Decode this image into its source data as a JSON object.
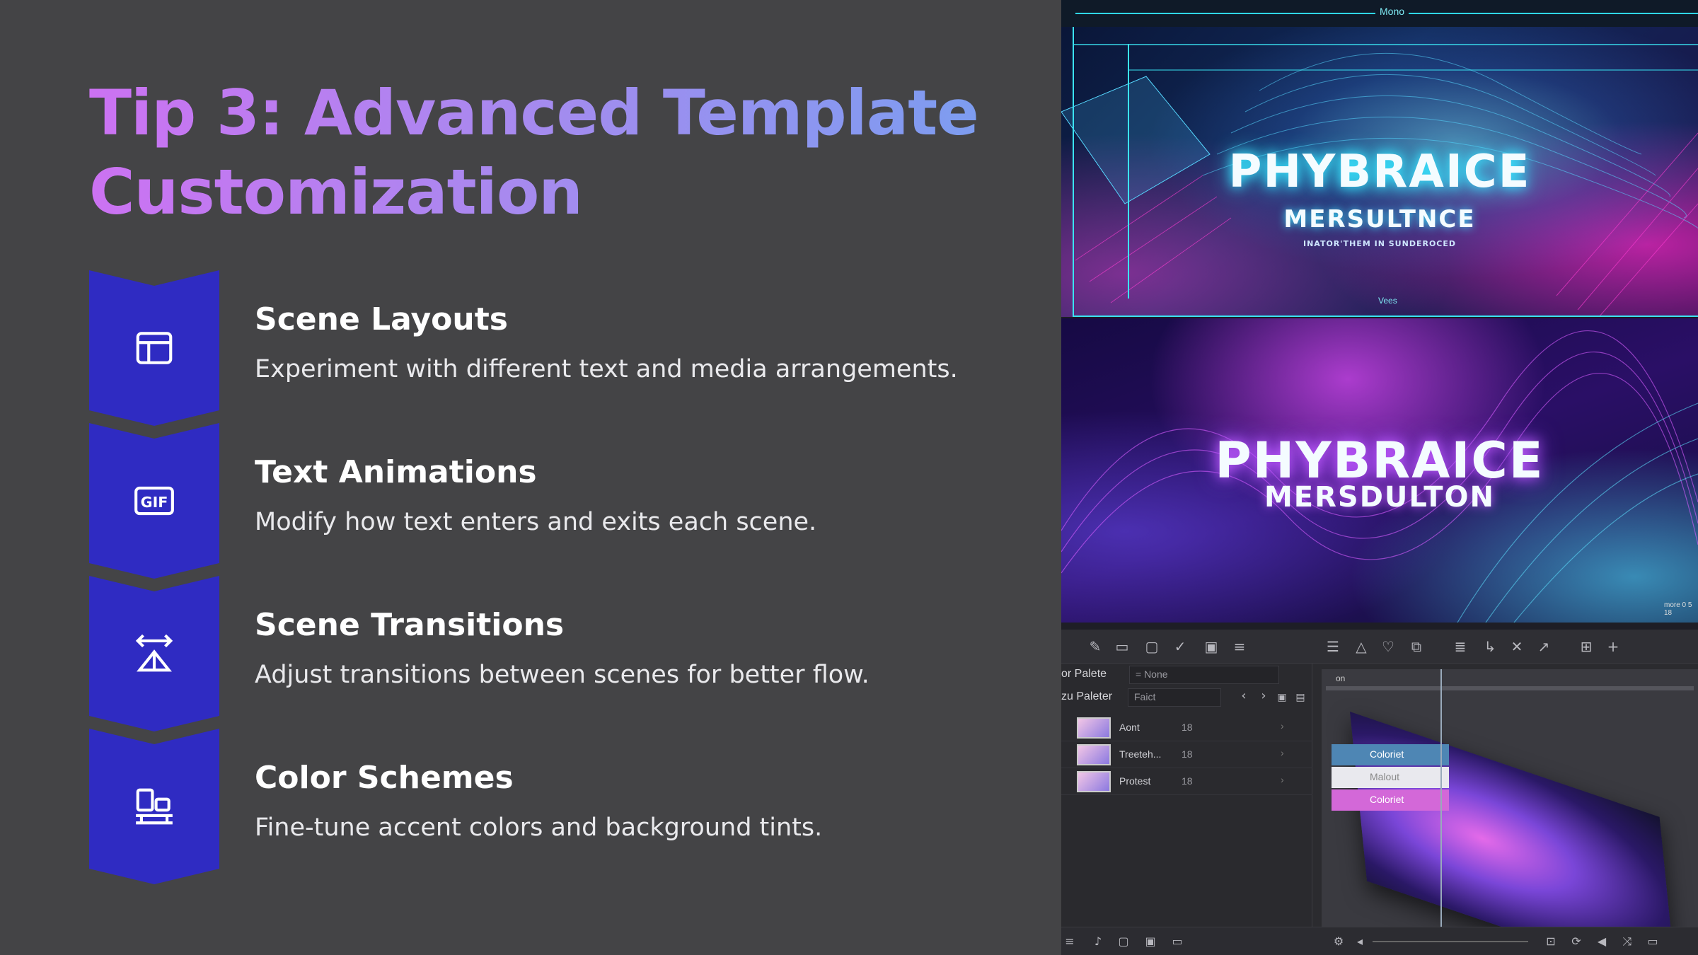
{
  "slide": {
    "title_line1": "Tip 3: Advanced Template",
    "title_line2": "Customization",
    "tips": [
      {
        "title": "Scene Layouts",
        "description": "Experiment with different text and media arrangements.",
        "icon": "layout-icon"
      },
      {
        "title": "Text Animations",
        "description": "Modify how text enters and exits each scene.",
        "icon": "gif-icon"
      },
      {
        "title": "Scene Transitions",
        "description": "Adjust transitions between scenes for better flow.",
        "icon": "transition-icon"
      },
      {
        "title": "Color Schemes",
        "description": "Fine-tune accent colors and background tints.",
        "icon": "color-scheme-icon"
      }
    ]
  },
  "screenshot": {
    "ruler_label": "Mono",
    "preview1": {
      "headline": "PHYBRAICE",
      "subheadline": "MERSULTNCE",
      "tagline": "INATOR'THEM IN SUNDEROCED",
      "guide_label": "Vees"
    },
    "preview2": {
      "headline": "PHYBRAICE",
      "subheadline": "MERSDULTON",
      "badge": "more 0 5 18"
    },
    "editor": {
      "palette_label": "or Palete",
      "palette_value": "= None",
      "paleter_label": "zu Paleter",
      "paleter_value": "Faict",
      "canvas_tab": "on",
      "layers": [
        {
          "name": "Aont",
          "value": "18"
        },
        {
          "name": "Treeteh...",
          "value": "18"
        },
        {
          "name": "Protest",
          "value": "18"
        }
      ],
      "context_menu": [
        "Coloriet",
        "Malout",
        "Coloriet"
      ]
    }
  },
  "colors": {
    "chevron": "#2f2bc2",
    "title_gradient_start": "#cc72f2",
    "title_gradient_end": "#7a9ef0",
    "background": "#444446"
  }
}
